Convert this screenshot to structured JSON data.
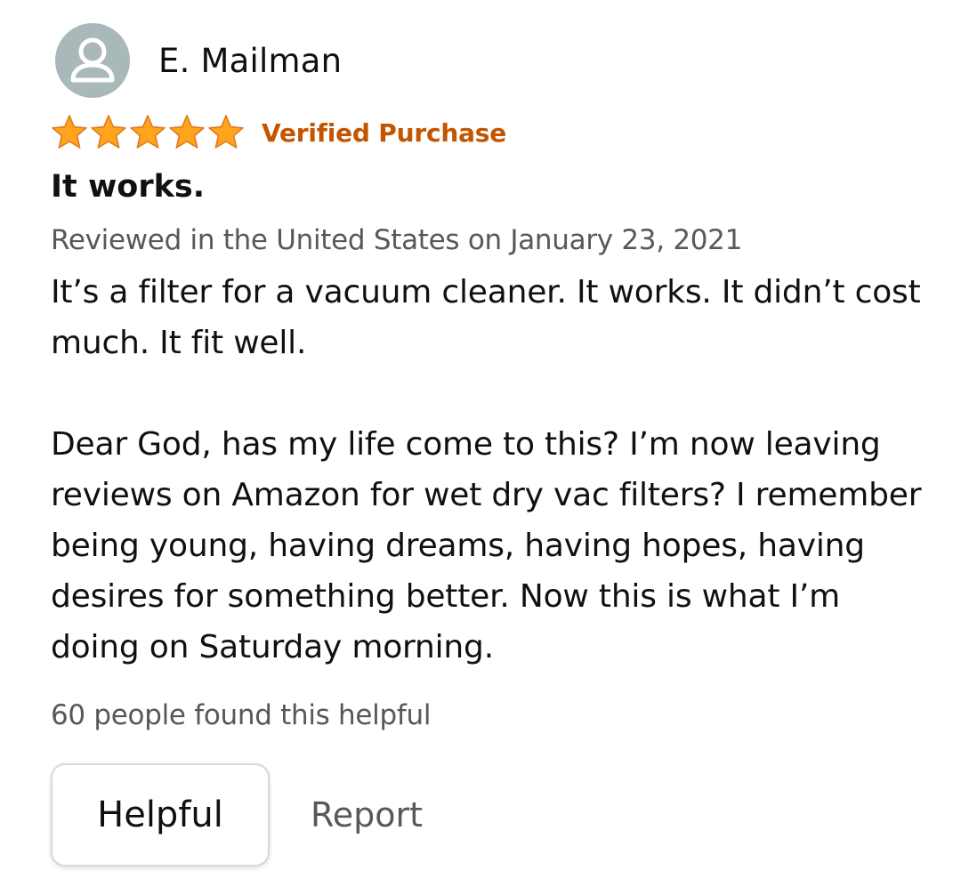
{
  "reviewer": {
    "name": "E. Mailman",
    "avatar_icon": "person-outline-icon"
  },
  "rating": {
    "stars": 5,
    "max": 5,
    "star_color": "#ffa41c",
    "star_outline_color": "#de7921"
  },
  "verified": {
    "label": "Verified Purchase",
    "color": "#c45500"
  },
  "review": {
    "title": "It works.",
    "date": "Reviewed in the United States on January 23, 2021",
    "paragraphs": [
      "It’s a filter for a vacuum cleaner. It works. It didn’t cost much. It fit well.",
      "Dear God, has my life come to this? I’m now leaving reviews on Amazon for wet dry vac filters? I remember being young, having dreams, having hopes, having desires for something better. Now this is what I’m doing on Saturday morning."
    ]
  },
  "helpful_count": "60 people found this helpful",
  "actions": {
    "helpful_label": "Helpful",
    "report_label": "Report"
  }
}
